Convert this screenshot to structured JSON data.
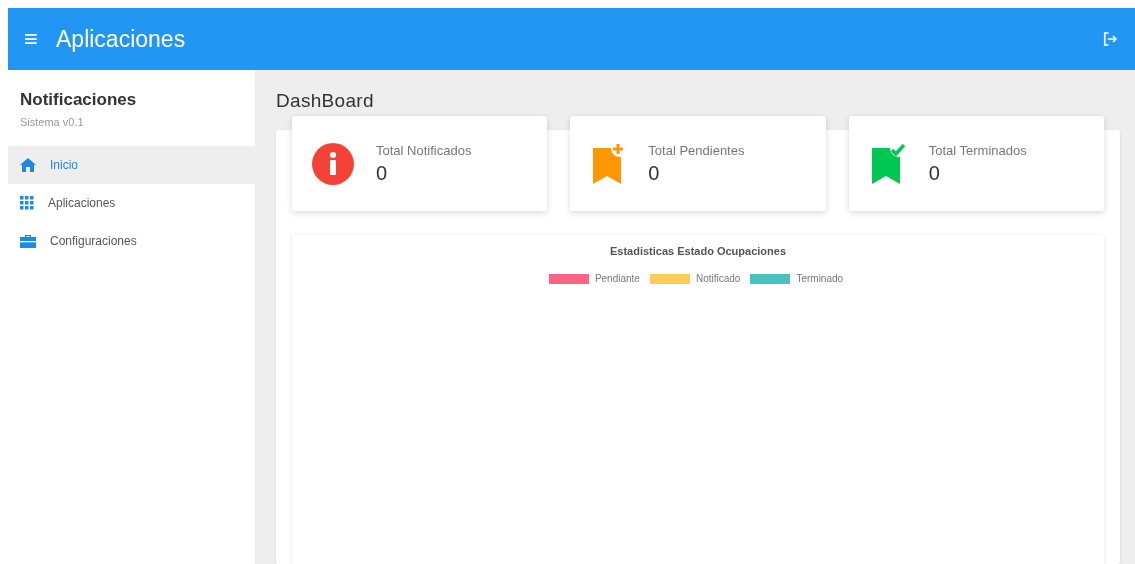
{
  "header": {
    "menu_icon": "≡",
    "title": "Aplicaciones"
  },
  "sidebar": {
    "title": "Notificaciones",
    "subtitle": "Sistema v0.1",
    "items": [
      {
        "label": "Inicio",
        "kind": "home",
        "selected": true
      },
      {
        "label": "Aplicaciones",
        "kind": "grid",
        "selected": false
      },
      {
        "label": "Configuraciones",
        "kind": "briefcase",
        "selected": false
      }
    ]
  },
  "page_title": "DashBoard",
  "stats": [
    {
      "label": "Total Notificados",
      "value": "0",
      "kind": "info",
      "color": "#f44336"
    },
    {
      "label": "Total Pendientes",
      "value": "0",
      "kind": "pending",
      "color": "#ff9800"
    },
    {
      "label": "Total Terminados",
      "value": "0",
      "kind": "done",
      "color": "#00c853"
    }
  ],
  "chart": {
    "title": "Estadisticas Estado Ocupaciones",
    "legend": [
      {
        "label": "Pendiante",
        "color": "#ff6384"
      },
      {
        "label": "Notificado",
        "color": "#ffcd56"
      },
      {
        "label": "Terminado",
        "color": "#4bc0c0"
      }
    ]
  }
}
